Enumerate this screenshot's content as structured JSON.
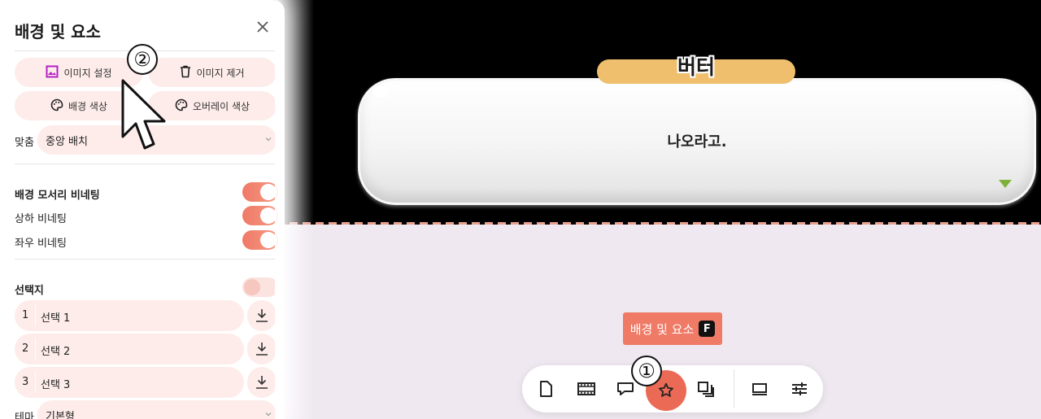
{
  "panel": {
    "title": "배경 및 요소",
    "close_icon": "close-icon",
    "image_set_label": "이미지 설정",
    "image_remove_label": "이미지 제거",
    "bg_color_label": "배경 색상",
    "overlay_color_label": "오버레이 색상",
    "fit_label": "맞춤",
    "fit_value": "중앙 배치",
    "vignette": {
      "corner_label": "배경 모서리 비네팅",
      "corner_on": true,
      "vertical_label": "상하 비네팅",
      "vertical_on": true,
      "horizontal_label": "좌우 비네팅",
      "horizontal_on": true
    },
    "choices": {
      "label": "선택지",
      "enabled": false,
      "items": [
        {
          "num": "1",
          "text": "선택 1"
        },
        {
          "num": "2",
          "text": "선택 2"
        },
        {
          "num": "3",
          "text": "선택 3"
        }
      ]
    },
    "theme_label": "테마",
    "theme_value": "기본형"
  },
  "stage": {
    "speaker": "버터",
    "dialog_text": "나오라고."
  },
  "tooltip": {
    "label": "배경 및 요소",
    "shortcut": "F"
  },
  "toolbar": {
    "items": [
      "page-icon",
      "film-icon",
      "speech-bubble-icon",
      "star-icon",
      "layers-icon",
      "frame-icon",
      "sliders-icon"
    ],
    "active": "star-icon"
  },
  "annotations": {
    "marker_1": "①",
    "marker_2": "②"
  },
  "colors": {
    "accent": "#ea6a55",
    "pill_bg": "#fdecea",
    "name_tag": "#efbf6e",
    "stage_bg": "#000000",
    "canvas_bg": "#efe8f0",
    "image_icon": "#b51fc8"
  }
}
